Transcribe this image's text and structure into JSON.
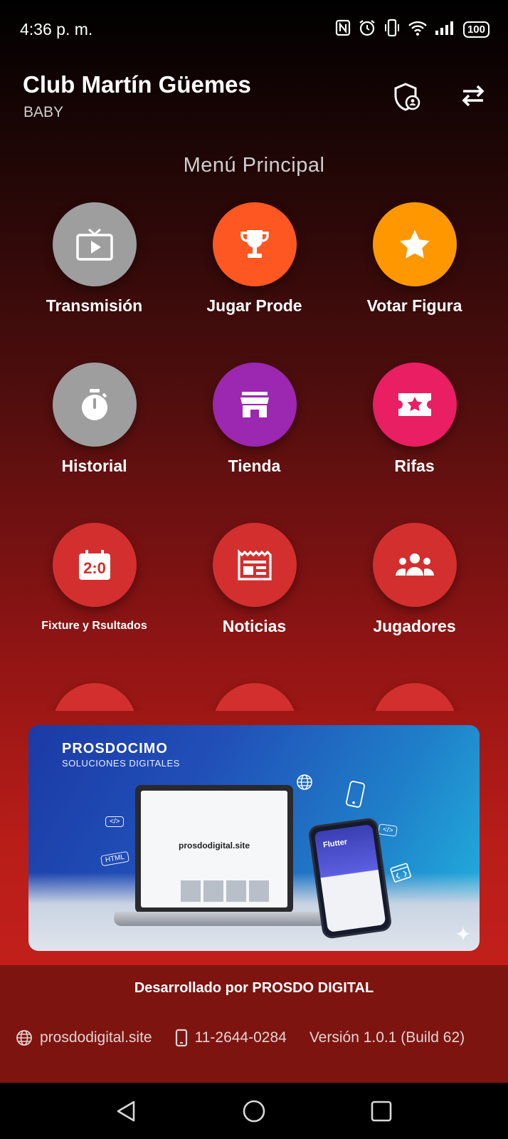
{
  "status_bar": {
    "time": "4:36 p. m.",
    "battery": "100",
    "icons": [
      "nfc-icon",
      "alarm-icon",
      "vibrate-icon",
      "wifi-icon",
      "signal-icon",
      "battery-icon"
    ]
  },
  "header": {
    "title": "Club Martín Güemes",
    "subtitle": "BABY",
    "actions": [
      "shield-user-icon",
      "swap-icon"
    ]
  },
  "menu": {
    "title": "Menú Principal",
    "items": [
      {
        "label": "Transmisión",
        "icon": "tv-icon",
        "color": "#9e9e9e"
      },
      {
        "label": "Jugar Prode",
        "icon": "trophy-icon",
        "color": "#ff5722"
      },
      {
        "label": "Votar Figura",
        "icon": "star-icon",
        "color": "#ff9800"
      },
      {
        "label": "Historial",
        "icon": "stopwatch-icon",
        "color": "#9e9e9e"
      },
      {
        "label": "Tienda",
        "icon": "store-icon",
        "color": "#9c27b0"
      },
      {
        "label": "Rifas",
        "icon": "ticket-icon",
        "color": "#e91e63"
      },
      {
        "label": "Fixture y Rsultados",
        "icon": "scoreboard-icon",
        "color": "#d32f2f"
      },
      {
        "label": "Noticias",
        "icon": "newspaper-icon",
        "color": "#d32f2f"
      },
      {
        "label": "Jugadores",
        "icon": "group-icon",
        "color": "#d32f2f"
      }
    ]
  },
  "banner": {
    "brand": "PROSDOCIMO",
    "brand_sub": "SOLUCIONES DIGITALES",
    "laptop_site": "prosdodigital.site",
    "phone_label": "Flutter",
    "tags": [
      "</>",
      "HTML",
      "</>"
    ]
  },
  "footer": {
    "credit": "Desarrollado por PROSDO DIGITAL",
    "website": "prosdodigital.site",
    "phone": "11-2644-0284",
    "version": "Versión 1.0.1 (Build 62)"
  },
  "nav": {
    "buttons": [
      "back-icon",
      "home-icon",
      "recents-icon"
    ]
  }
}
